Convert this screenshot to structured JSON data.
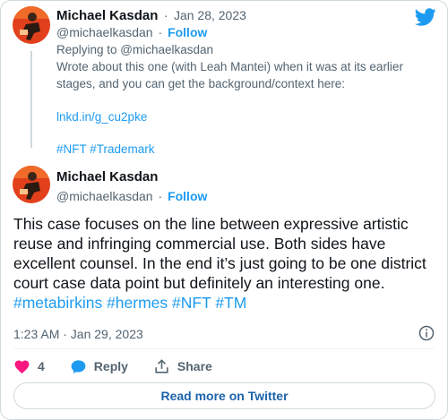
{
  "reply_tweet": {
    "author_name": "Michael Kasdan",
    "separator": "·",
    "date": "Jan 28, 2023",
    "handle": "@michaelkasdan",
    "follow_label": "Follow",
    "replying_to": "Replying to @michaelkasdan",
    "text_line1": "Wrote about this one (with Leah Mantei) when it was at its earlier",
    "text_line2": "stages, and you can get the background/context here:",
    "link": "lnkd.in/g_cu2pke",
    "hashtags": "#NFT #Trademark"
  },
  "main_tweet": {
    "author_name": "Michael Kasdan",
    "handle": "@michaelkasdan",
    "separator": "·",
    "follow_label": "Follow",
    "body_plain": "This case focuses on the line between expressive artistic reuse and infringing commercial use. Both sides have excellent counsel. In the end it’s just going to be one district court case data point but definitely an interesting one. ",
    "body_hashtags": "#metabirkins #hermes #NFT #TM",
    "timestamp": "1:23 AM · Jan 29, 2023"
  },
  "actions": {
    "like_count": "4",
    "reply_label": "Reply",
    "share_label": "Share"
  },
  "read_more_label": "Read more on Twitter",
  "colors": {
    "accent": "#1d9bf0",
    "like": "#f91880",
    "muted": "#536471",
    "text": "#0f1419"
  },
  "icons": [
    "twitter-bird-icon",
    "info-icon",
    "heart-icon",
    "reply-bubble-icon",
    "share-icon"
  ]
}
